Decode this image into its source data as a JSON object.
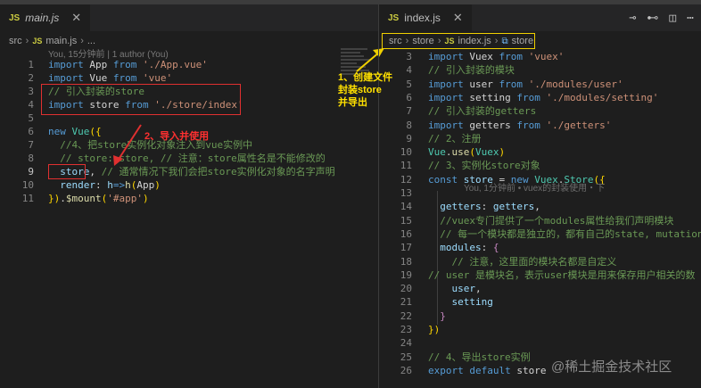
{
  "left": {
    "tab": {
      "file": "main.js"
    },
    "breadcrumb": [
      "src",
      "main.js",
      "..."
    ],
    "blame": "You, 15分钟前 | 1 author (You)",
    "lines": [
      {
        "n": "1",
        "tokens": [
          [
            "k",
            "import"
          ],
          [
            "p",
            " App "
          ],
          [
            "k",
            "from"
          ],
          [
            "p",
            " "
          ],
          [
            "s",
            "'./App.vue'"
          ]
        ]
      },
      {
        "n": "2",
        "tokens": [
          [
            "k",
            "import"
          ],
          [
            "p",
            " Vue "
          ],
          [
            "k",
            "from"
          ],
          [
            "p",
            " "
          ],
          [
            "s",
            "'vue'"
          ]
        ]
      },
      {
        "n": "3",
        "tokens": [
          [
            "c",
            "// 引入封装的store"
          ]
        ]
      },
      {
        "n": "4",
        "tokens": [
          [
            "k",
            "import"
          ],
          [
            "p",
            " store "
          ],
          [
            "k",
            "from"
          ],
          [
            "p",
            " "
          ],
          [
            "s",
            "'./store/index'"
          ]
        ]
      },
      {
        "n": "5",
        "tokens": []
      },
      {
        "n": "6",
        "tokens": [
          [
            "k",
            "new"
          ],
          [
            "p",
            " "
          ],
          [
            "t",
            "Vue"
          ],
          [
            "y",
            "({"
          ]
        ]
      },
      {
        "n": "7",
        "tokens": [
          [
            "c",
            "  //4、把store实例化对象注入到vue实例中"
          ]
        ]
      },
      {
        "n": "8",
        "tokens": [
          [
            "c",
            "  // store: store, // 注意：store属性名是不能修改的"
          ]
        ]
      },
      {
        "n": "9",
        "tokens": [
          [
            "p",
            "  "
          ],
          [
            "v",
            "store"
          ],
          [
            "p",
            ", "
          ],
          [
            "c",
            "// 通常情况下我们会把store实例化对象的名字声明"
          ]
        ]
      },
      {
        "n": "10",
        "tokens": [
          [
            "p",
            "  "
          ],
          [
            "v",
            "render"
          ],
          [
            "p",
            ": "
          ],
          [
            "v",
            "h"
          ],
          [
            "k",
            "=>"
          ],
          [
            "f",
            "h"
          ],
          [
            "y",
            "("
          ],
          [
            "p",
            "App"
          ],
          [
            "y",
            ")"
          ]
        ]
      },
      {
        "n": "11",
        "tokens": [
          [
            "y",
            "})"
          ],
          [
            "p",
            "."
          ],
          [
            "f",
            "$mount"
          ],
          [
            "y",
            "("
          ],
          [
            "s",
            "'#app'"
          ],
          [
            "y",
            ")"
          ]
        ]
      }
    ],
    "annotation": "2、导入并使用"
  },
  "right": {
    "tab": {
      "file": "index.js"
    },
    "breadcrumb": [
      "src",
      "store",
      "index.js",
      "store"
    ],
    "annotation": [
      "1、创建文件",
      "封装store",
      "并导出"
    ],
    "inline_blame": "You, 1分钟前 • vuex的封装使用・下",
    "lines": [
      {
        "n": "3",
        "tokens": [
          [
            "k",
            "import"
          ],
          [
            "p",
            " Vuex "
          ],
          [
            "k",
            "from"
          ],
          [
            "p",
            " "
          ],
          [
            "s",
            "'vuex'"
          ]
        ]
      },
      {
        "n": "4",
        "tokens": [
          [
            "c",
            "// 引入封装的模块"
          ]
        ]
      },
      {
        "n": "5",
        "tokens": [
          [
            "k",
            "import"
          ],
          [
            "p",
            " user "
          ],
          [
            "k",
            "from"
          ],
          [
            "p",
            " "
          ],
          [
            "s",
            "'./modules/user'"
          ]
        ]
      },
      {
        "n": "6",
        "tokens": [
          [
            "k",
            "import"
          ],
          [
            "p",
            " setting "
          ],
          [
            "k",
            "from"
          ],
          [
            "p",
            " "
          ],
          [
            "s",
            "'./modules/setting'"
          ]
        ]
      },
      {
        "n": "7",
        "tokens": [
          [
            "c",
            "// 引入封装的getters"
          ]
        ]
      },
      {
        "n": "8",
        "tokens": [
          [
            "k",
            "import"
          ],
          [
            "p",
            " getters "
          ],
          [
            "k",
            "from"
          ],
          [
            "p",
            " "
          ],
          [
            "s",
            "'./getters'"
          ]
        ]
      },
      {
        "n": "9",
        "tokens": [
          [
            "c",
            "// 2、注册"
          ]
        ]
      },
      {
        "n": "10",
        "tokens": [
          [
            "t",
            "Vue"
          ],
          [
            "p",
            "."
          ],
          [
            "f",
            "use"
          ],
          [
            "y",
            "("
          ],
          [
            "t",
            "Vuex"
          ],
          [
            "y",
            ")"
          ]
        ]
      },
      {
        "n": "11",
        "tokens": [
          [
            "c",
            "// 3、实例化store对象"
          ]
        ]
      },
      {
        "n": "12",
        "tokens": [
          [
            "k",
            "const"
          ],
          [
            "p",
            " "
          ],
          [
            "v",
            "store"
          ],
          [
            "p",
            " = "
          ],
          [
            "k",
            "new"
          ],
          [
            "p",
            " "
          ],
          [
            "t",
            "Vuex"
          ],
          [
            "p",
            "."
          ],
          [
            "t",
            "Store"
          ],
          [
            "y",
            "({"
          ]
        ]
      },
      {
        "n": "13",
        "tokens": []
      },
      {
        "n": "14",
        "tokens": [
          [
            "p",
            "  "
          ],
          [
            "v",
            "getters"
          ],
          [
            "p",
            ": "
          ],
          [
            "v",
            "getters"
          ],
          [
            "p",
            ","
          ]
        ]
      },
      {
        "n": "15",
        "tokens": [
          [
            "c",
            "  //vuex专门提供了一个modules属性给我们声明模块"
          ]
        ]
      },
      {
        "n": "16",
        "tokens": [
          [
            "c",
            "  // 每一个模块都是独立的，都有自己的state, mutation"
          ]
        ]
      },
      {
        "n": "17",
        "tokens": [
          [
            "p",
            "  "
          ],
          [
            "v",
            "modules"
          ],
          [
            "p",
            ": "
          ],
          [
            "kc",
            "{"
          ]
        ]
      },
      {
        "n": "18",
        "tokens": [
          [
            "c",
            "    // 注意，这里面的模块名都是自定义"
          ]
        ]
      },
      {
        "n": "19",
        "tokens": [
          [
            "c",
            "// user 是模块名，表示user模块是用来保存用户相关的数"
          ]
        ]
      },
      {
        "n": "20",
        "tokens": [
          [
            "p",
            "    "
          ],
          [
            "v",
            "user"
          ],
          [
            "p",
            ","
          ]
        ]
      },
      {
        "n": "21",
        "tokens": [
          [
            "p",
            "    "
          ],
          [
            "v",
            "setting"
          ]
        ]
      },
      {
        "n": "22",
        "tokens": [
          [
            "kc",
            "  }"
          ]
        ]
      },
      {
        "n": "23",
        "tokens": [
          [
            "y",
            "})"
          ]
        ]
      },
      {
        "n": "24",
        "tokens": []
      },
      {
        "n": "25",
        "tokens": [
          [
            "c",
            "// 4、导出store实例"
          ]
        ]
      },
      {
        "n": "26",
        "tokens": [
          [
            "k",
            "export"
          ],
          [
            "p",
            " "
          ],
          [
            "k",
            "default"
          ],
          [
            "p",
            " store"
          ]
        ]
      }
    ]
  },
  "watermark": "@稀土掘金技术社区",
  "icons": {
    "split": "split-editor-icon",
    "more": "more-actions-icon",
    "compare": "compare-icon"
  }
}
